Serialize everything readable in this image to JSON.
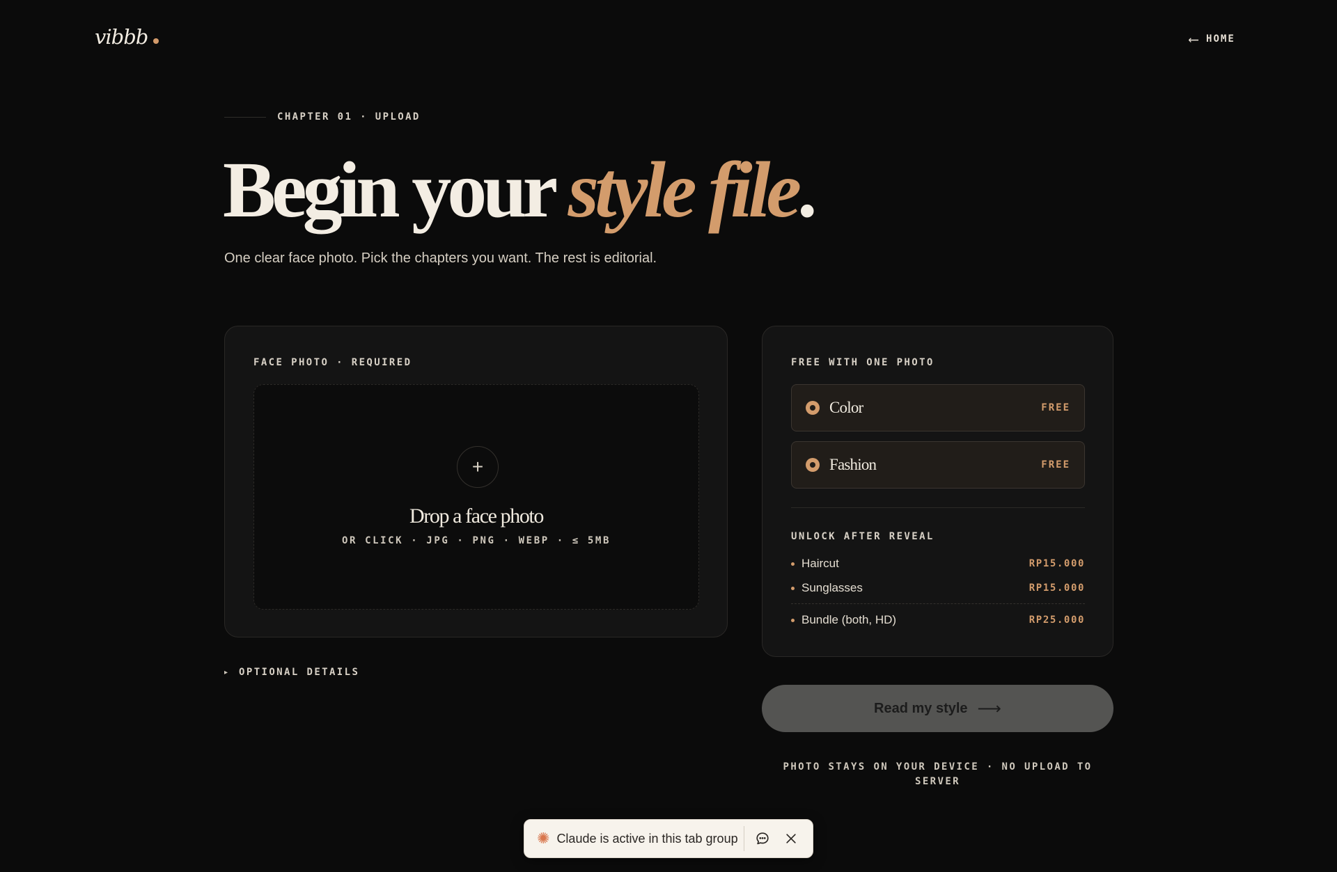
{
  "header": {
    "logo": "vibbb",
    "home_label": "HOME",
    "home_arrow": "⟵"
  },
  "hero": {
    "chapter": "CHAPTER 01 · UPLOAD",
    "title_main": "Begin your ",
    "title_accent": "style file",
    "title_end": ".",
    "subtitle": "One clear face photo. Pick the chapters you want. The rest is editorial."
  },
  "upload": {
    "label": "FACE PHOTO · REQUIRED",
    "plus": "+",
    "drop_title": "Drop a face photo",
    "drop_hint": "OR CLICK · JPG · PNG · WEBP · ≤ 5MB"
  },
  "optional": {
    "toggle": "▸",
    "label": "OPTIONAL DETAILS"
  },
  "pricing": {
    "free_label": "FREE WITH ONE PHOTO",
    "free_options": [
      {
        "name": "Color",
        "tag": "FREE"
      },
      {
        "name": "Fashion",
        "tag": "FREE"
      }
    ],
    "unlock_label": "UNLOCK AFTER REVEAL",
    "unlock_items": [
      {
        "name": "Haircut",
        "price": "RP15.000"
      },
      {
        "name": "Sunglasses",
        "price": "RP15.000"
      },
      {
        "name": "Bundle (both, HD)",
        "price": "RP25.000"
      }
    ]
  },
  "cta": {
    "label": "Read my style",
    "arrow": "⟶"
  },
  "privacy": "PHOTO STAYS ON YOUR DEVICE · NO UPLOAD TO SERVER",
  "extension": {
    "text": "Claude is active in this tab group"
  },
  "colors": {
    "background": "#0b0b0b",
    "accent": "#d39c6c",
    "cta": "#545452"
  }
}
